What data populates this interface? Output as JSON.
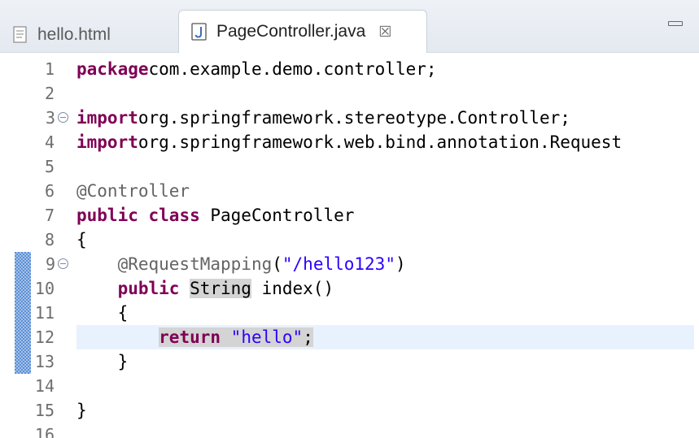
{
  "tabs": [
    {
      "label": "hello.html",
      "icon": "html-file-icon",
      "active": false
    },
    {
      "label": "PageController.java",
      "icon": "java-file-icon",
      "active": true,
      "close": "☒"
    }
  ],
  "lines": [
    {
      "num": "1",
      "segments": [
        [
          "kw",
          "package"
        ],
        [
          "",
          "com.example.demo.controller;"
        ]
      ]
    },
    {
      "num": "2",
      "segments": []
    },
    {
      "num": "3",
      "fold": true,
      "segments": [
        [
          "kw",
          "import"
        ],
        [
          "",
          "org.springframework.stereotype.Controller;"
        ]
      ]
    },
    {
      "num": "4",
      "segments": [
        [
          "kw",
          "import"
        ],
        [
          "",
          "org.springframework.web.bind.annotation.Request"
        ]
      ]
    },
    {
      "num": "5",
      "segments": []
    },
    {
      "num": "6",
      "segments": [
        [
          "ann",
          "@Controller"
        ]
      ]
    },
    {
      "num": "7",
      "segments": [
        [
          "kw",
          "public"
        ],
        [
          "",
          " "
        ],
        [
          "kw",
          "class"
        ],
        [
          "",
          " PageController"
        ]
      ]
    },
    {
      "num": "8",
      "segments": [
        [
          "",
          "{"
        ]
      ]
    },
    {
      "num": "9",
      "fold": true,
      "segments": [
        [
          "",
          "    "
        ],
        [
          "ann",
          "@RequestMapping"
        ],
        [
          "",
          "("
        ],
        [
          "str",
          "\"/hello123\""
        ],
        [
          "",
          ")"
        ]
      ]
    },
    {
      "num": "10",
      "segments": [
        [
          "",
          "    "
        ],
        [
          "kw",
          "public"
        ],
        [
          "",
          " "
        ],
        [
          "occ",
          "String"
        ],
        [
          "",
          " index()"
        ]
      ]
    },
    {
      "num": "11",
      "segments": [
        [
          "",
          "    {"
        ]
      ]
    },
    {
      "num": "12",
      "current": true,
      "segments": [
        [
          "",
          "        "
        ],
        [
          "kw occ",
          "return"
        ],
        [
          "occ",
          " "
        ],
        [
          "str occ",
          "\"hello\""
        ],
        [
          "occ",
          ";"
        ]
      ]
    },
    {
      "num": "13",
      "segments": [
        [
          "",
          "    }"
        ]
      ]
    },
    {
      "num": "14",
      "segments": []
    },
    {
      "num": "15",
      "segments": [
        [
          "",
          "}"
        ]
      ]
    },
    {
      "num": "16",
      "segments": []
    }
  ],
  "colors": {
    "keyword": "#7f0055",
    "annotation": "#646464",
    "string": "#2a00ff",
    "current_line": "#e8f2fe",
    "change_bar": "#5b8fd6"
  }
}
